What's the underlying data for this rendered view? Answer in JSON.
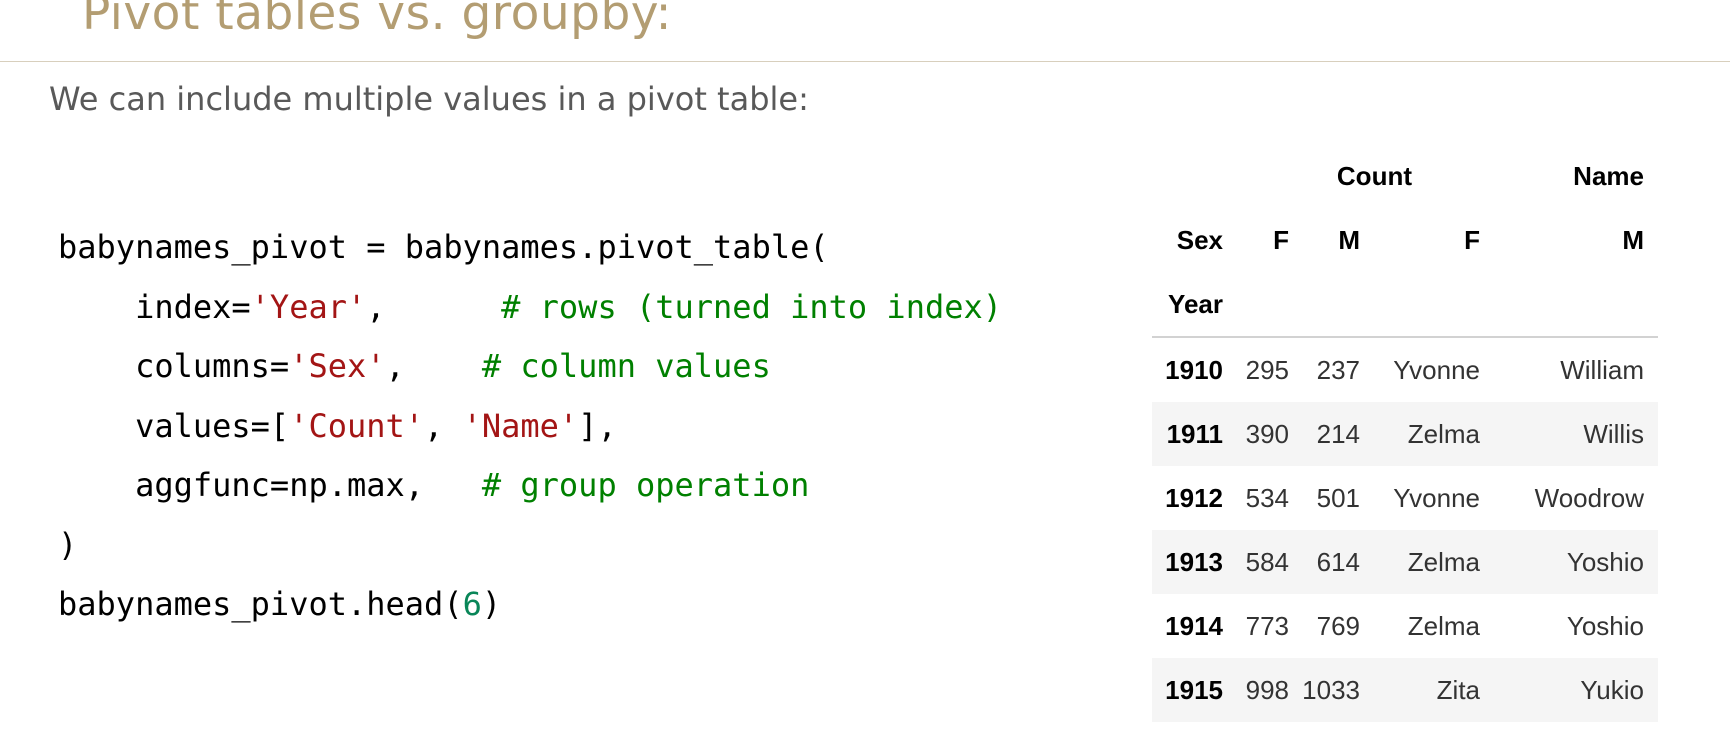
{
  "slide": {
    "title": "Pivot tables vs. groupby:",
    "subtitle": "We can include multiple values in a pivot table:"
  },
  "code": {
    "line1": "babynames_pivot = babynames.pivot_table(",
    "line2_key": "    index=",
    "line2_val": "'Year'",
    "line2_sep": ",      ",
    "line2_comment": "# rows (turned into index)",
    "line3_key": "    columns=",
    "line3_val": "'Sex'",
    "line3_sep": ",    ",
    "line3_comment": "# column values",
    "line4_key": "    values=[",
    "line4_val1": "'Count'",
    "line4_mid": ", ",
    "line4_val2": "'Name'",
    "line4_end": "],",
    "line5_key": "    aggfunc=np.max,   ",
    "line5_comment": "# group operation",
    "line6": ")",
    "line7_start": "babynames_pivot.head(",
    "line7_num": "6",
    "line7_end": ")"
  },
  "table": {
    "top_headers": [
      "Count",
      "Name"
    ],
    "sex_label": "Sex",
    "sex_values": [
      "F",
      "M",
      "F",
      "M"
    ],
    "index_name": "Year",
    "rows": [
      {
        "year": "1910",
        "count_f": "295",
        "count_m": "237",
        "name_f": "Yvonne",
        "name_m": "William"
      },
      {
        "year": "1911",
        "count_f": "390",
        "count_m": "214",
        "name_f": "Zelma",
        "name_m": "Willis"
      },
      {
        "year": "1912",
        "count_f": "534",
        "count_m": "501",
        "name_f": "Yvonne",
        "name_m": "Woodrow"
      },
      {
        "year": "1913",
        "count_f": "584",
        "count_m": "614",
        "name_f": "Zelma",
        "name_m": "Yoshio"
      },
      {
        "year": "1914",
        "count_f": "773",
        "count_m": "769",
        "name_f": "Zelma",
        "name_m": "Yoshio"
      },
      {
        "year": "1915",
        "count_f": "998",
        "count_m": "1033",
        "name_f": "Zita",
        "name_m": "Yukio"
      }
    ]
  }
}
